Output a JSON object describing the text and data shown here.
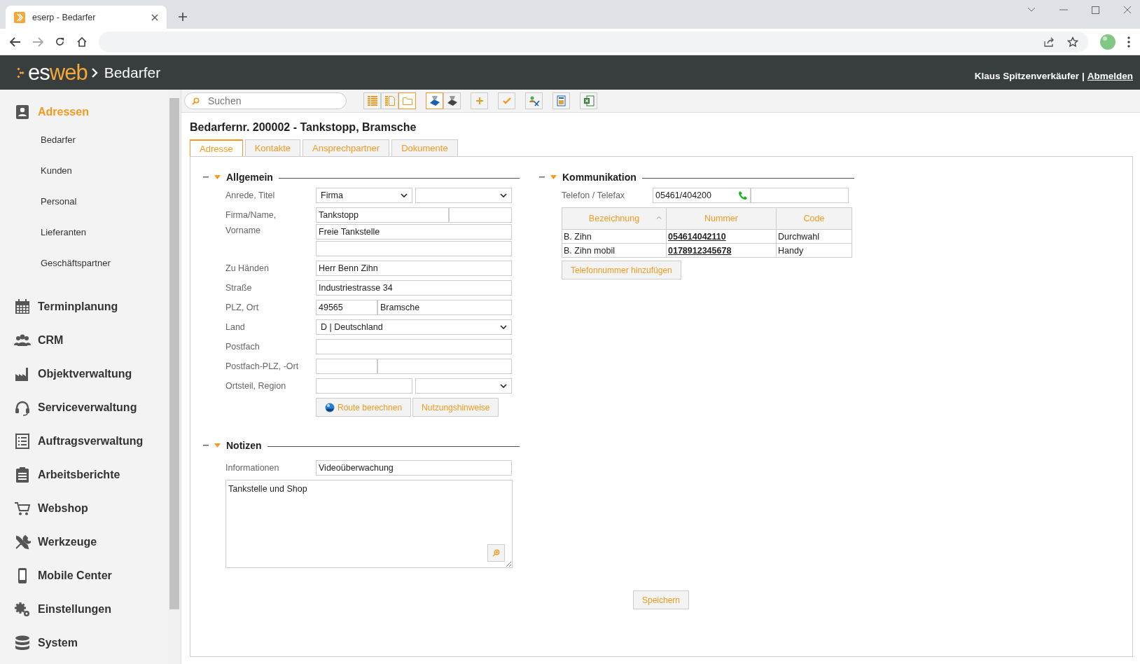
{
  "browser": {
    "tab_title": "eserp - Bedarfer"
  },
  "app_header": {
    "logo_lead": "es",
    "logo_accent": "web",
    "breadcrumb": "Bedarfer",
    "user": "Klaus Spitzenverkäufer",
    "separator": "|",
    "logout": "Abmelden"
  },
  "sidebar": {
    "items": [
      {
        "label": "Adressen",
        "kind": "contact",
        "selected": true,
        "children": [
          {
            "label": "Bedarfer",
            "selected": false
          },
          {
            "label": "Kunden",
            "selected": false
          },
          {
            "label": "Personal",
            "selected": false
          },
          {
            "label": "Lieferanten",
            "selected": false
          },
          {
            "label": "Geschäftspartner",
            "selected": false
          }
        ]
      },
      {
        "label": "Terminplanung",
        "kind": "calendar",
        "selected": false
      },
      {
        "label": "CRM",
        "kind": "people",
        "selected": false
      },
      {
        "label": "Objektverwaltung",
        "kind": "factory",
        "selected": false
      },
      {
        "label": "Serviceverwaltung",
        "kind": "headset",
        "selected": false
      },
      {
        "label": "Auftragsverwaltung",
        "kind": "list",
        "selected": false
      },
      {
        "label": "Arbeitsberichte",
        "kind": "clipboard",
        "selected": false
      },
      {
        "label": "Webshop",
        "kind": "cart",
        "selected": false
      },
      {
        "label": "Werkzeuge",
        "kind": "tools",
        "selected": false
      },
      {
        "label": "Mobile Center",
        "kind": "phone",
        "selected": false
      },
      {
        "label": "Einstellungen",
        "kind": "gears",
        "selected": false
      },
      {
        "label": "System",
        "kind": "database",
        "selected": false
      }
    ]
  },
  "toolbar": {
    "search": {
      "placeholder": "Suchen"
    },
    "groups": [
      [
        {
          "kind": "list-view",
          "selected": false
        },
        {
          "kind": "detail-view",
          "selected": false
        },
        {
          "kind": "folder-view",
          "selected": true
        }
      ],
      [
        {
          "kind": "filter-blue",
          "selected": true
        },
        {
          "kind": "filter-grey",
          "selected": false
        }
      ],
      [
        {
          "kind": "plus"
        }
      ],
      [
        {
          "kind": "check"
        }
      ],
      [
        {
          "kind": "people"
        }
      ],
      [
        {
          "kind": "report"
        }
      ],
      [
        {
          "kind": "excel"
        }
      ]
    ]
  },
  "title": "Bedarfernr. 200002 - Tankstopp, Bramsche",
  "tabs": [
    {
      "label": "Adresse",
      "selected": true
    },
    {
      "label": "Kontakte",
      "selected": false
    },
    {
      "label": "Ansprechpartner",
      "selected": false
    },
    {
      "label": "Dokumente",
      "selected": false
    }
  ],
  "allgemein": {
    "title": "Allgemein",
    "expanded": true,
    "rows": [
      {
        "kind": "pair-select",
        "label": "Anrede, Titel",
        "fields": [
          {
            "kind": "select",
            "value": "Firma"
          },
          {
            "kind": "select"
          }
        ]
      },
      {
        "kind": "name",
        "label": "Firma/Name, Vorname",
        "fields": [
          {
            "kind": "input",
            "value": "Tankstopp"
          },
          {
            "kind": "input"
          },
          {
            "kind": "input",
            "value": "Freie Tankstelle"
          },
          {
            "kind": "input"
          }
        ]
      },
      {
        "kind": "single",
        "label": "Zu Händen",
        "fields": [
          {
            "kind": "input",
            "value": "Herr Benn Zihn"
          }
        ]
      },
      {
        "kind": "single",
        "label": "Straße",
        "fields": [
          {
            "kind": "input",
            "value": "Industriestrasse 34"
          }
        ]
      },
      {
        "kind": "zip",
        "label": "PLZ, Ort",
        "fields": [
          {
            "kind": "input",
            "value": "49565"
          },
          {
            "kind": "input",
            "value": "Bramsche"
          }
        ]
      },
      {
        "kind": "select-wide",
        "label": "Land",
        "fields": [
          {
            "kind": "select",
            "value": "D | Deutschland"
          }
        ]
      },
      {
        "kind": "single",
        "label": "Postfach",
        "fields": [
          {
            "kind": "input"
          }
        ]
      },
      {
        "kind": "zip",
        "label": "Postfach-PLZ, -Ort",
        "fields": [
          {
            "kind": "input"
          },
          {
            "kind": "input"
          }
        ]
      },
      {
        "kind": "input-select",
        "label": "Ortsteil, Region",
        "fields": [
          {
            "kind": "input"
          },
          {
            "kind": "select"
          }
        ]
      }
    ],
    "buttons": [
      {
        "label": "Route berechnen",
        "kind": "globe"
      },
      {
        "label": "Nutzungshinweise",
        "kind": "plain"
      }
    ]
  },
  "notizen": {
    "title": "Notizen",
    "expanded": true,
    "info_label": "Informationen",
    "info_value": "Videoüberwachung",
    "notes": "Tankstelle und Shop"
  },
  "kommunikation": {
    "title": "Kommunikation",
    "expanded": true,
    "phone_label": "Telefon / Telefax",
    "phone": "05461/404200",
    "columns": [
      {
        "label": "Bezeichnung",
        "sorted": true
      },
      {
        "label": "Nummer"
      },
      {
        "label": "Code"
      }
    ],
    "rows": [
      {
        "name": "B. Zihn",
        "number": "054614042110",
        "code": "Durchwahl"
      },
      {
        "name": "B. Zihn mobil",
        "number": "0178912345678",
        "code": "Handy"
      }
    ],
    "add_button": "Telefonnummer hinzufügen"
  },
  "save_button": "Speichern"
}
